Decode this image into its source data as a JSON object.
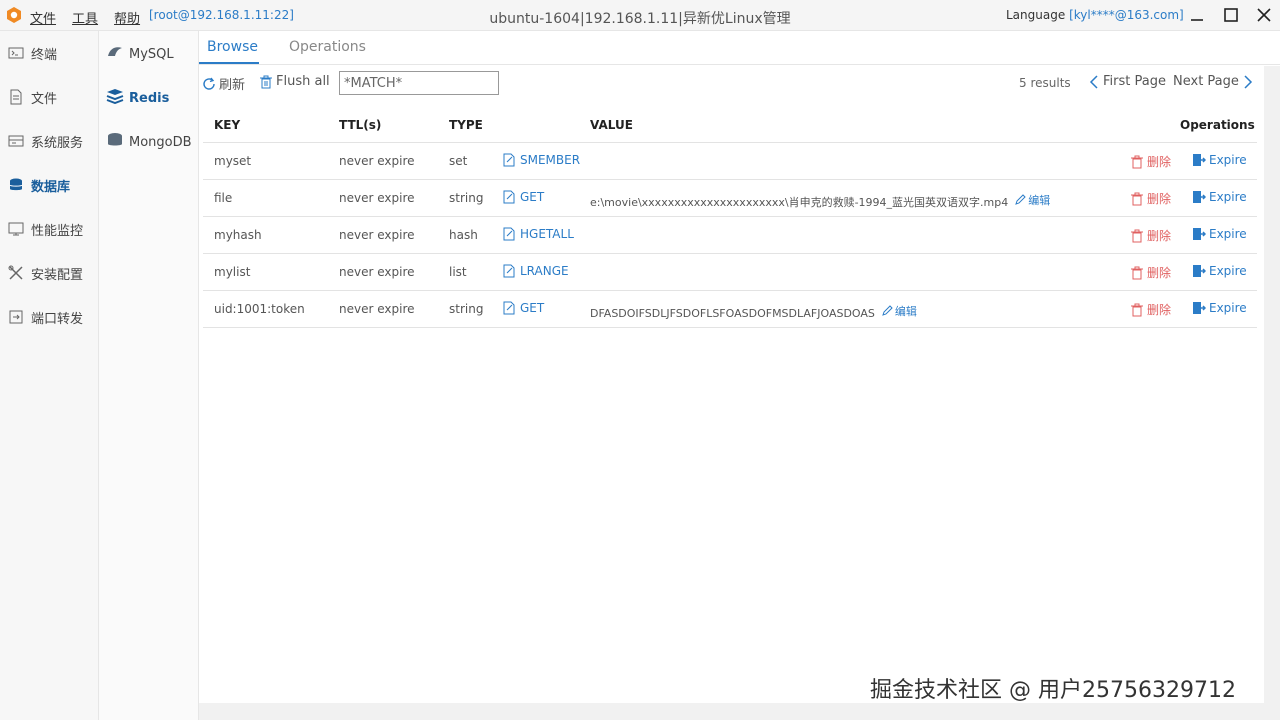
{
  "titlebar": {
    "menu": [
      "文件",
      "工具",
      "帮助"
    ],
    "connection": "[root@192.168.1.11:22]",
    "window_title": "ubuntu-1604|192.168.1.11|异新优Linux管理",
    "language_label": "Language",
    "account": "[kyl****@163.com]"
  },
  "leftnav": {
    "items": [
      {
        "label": "终端",
        "icon": "terminal-icon"
      },
      {
        "label": "文件",
        "icon": "file-icon"
      },
      {
        "label": "系统服务",
        "icon": "service-icon"
      },
      {
        "label": "数据库",
        "icon": "database-icon",
        "active": true
      },
      {
        "label": "性能监控",
        "icon": "monitor-icon"
      },
      {
        "label": "安装配置",
        "icon": "tools-icon"
      },
      {
        "label": "端口转发",
        "icon": "forward-icon"
      }
    ]
  },
  "dbnav": {
    "items": [
      {
        "label": "MySQL",
        "icon": "mysql-icon"
      },
      {
        "label": "Redis",
        "icon": "redis-icon",
        "active": true
      },
      {
        "label": "MongoDB",
        "icon": "mongodb-icon"
      }
    ]
  },
  "tabs": [
    "Browse",
    "Operations"
  ],
  "toolbar": {
    "refresh_label": "刷新",
    "flush_label": "Flush all",
    "match_value": "*MATCH*",
    "results": "5 results",
    "first_page": "First Page",
    "next_page": "Next Page"
  },
  "table": {
    "headers": {
      "key": "KEY",
      "ttl": "TTL(s)",
      "type": "TYPE",
      "value": "VALUE",
      "operations": "Operations"
    },
    "rows": [
      {
        "key": "myset",
        "ttl": "never expire",
        "type": "set",
        "cmd": "SMEMBER",
        "value": "",
        "edit": ""
      },
      {
        "key": "file",
        "ttl": "never expire",
        "type": "string",
        "cmd": "GET",
        "value": "e:\\movie\\xxxxxxxxxxxxxxxxxxxxxx\\肖申克的救赎-1994_蓝光国英双语双字.mp4",
        "edit": "编辑"
      },
      {
        "key": "myhash",
        "ttl": "never expire",
        "type": "hash",
        "cmd": "HGETALL",
        "value": "",
        "edit": ""
      },
      {
        "key": "mylist",
        "ttl": "never expire",
        "type": "list",
        "cmd": "LRANGE",
        "value": "",
        "edit": ""
      },
      {
        "key": "uid:1001:token",
        "ttl": "never expire",
        "type": "string",
        "cmd": "GET",
        "value": "DFASDOIFSDLJFSDOFLSFOASDOFMSDLAFJOASDOAS",
        "edit": "编辑"
      }
    ],
    "delete_label": "删除",
    "expire_label": "Expire"
  },
  "watermark": "掘金技术社区 @ 用户25756329712",
  "colors": {
    "accent": "#2b7cc7",
    "danger": "#e06060",
    "logo": "#f08a24"
  }
}
